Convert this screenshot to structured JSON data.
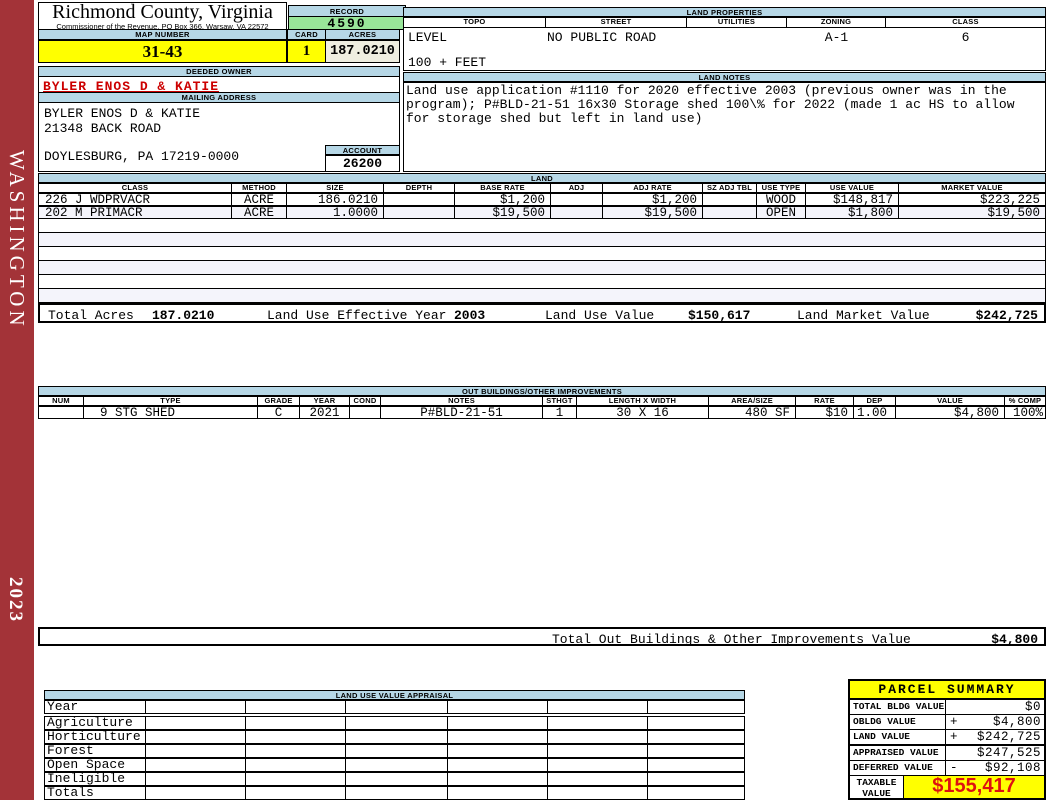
{
  "sidebar": {
    "county": "WASHINGTON",
    "year": "2023"
  },
  "header": {
    "county_title": "Richmond County, Virginia",
    "commissioner_line": "Commissioner of the Revenue, PO Box 366, Warsaw, VA 22572",
    "record_label": "RECORD",
    "record_value": "4590",
    "map_number_label": "MAP NUMBER",
    "map_number_value": "31-43",
    "card_label": "CARD",
    "card_value": "1",
    "acres_label": "ACRES",
    "acres_value": "187.0210"
  },
  "owner": {
    "deeded_owner_label": "DEEDED OWNER",
    "deeded_owner": "BYLER ENOS D & KATIE",
    "mailing_address_label": "MAILING ADDRESS",
    "mailing_line1": "BYLER ENOS D & KATIE",
    "mailing_line2": "21348 BACK ROAD",
    "mailing_city": "DOYLESBURG, PA 17219-0000",
    "account_label": "ACCOUNT",
    "account_value": "26200"
  },
  "land_properties": {
    "title": "LAND PROPERTIES",
    "columns": [
      "TOPO",
      "STREET",
      "UTILITIES",
      "ZONING",
      "CLASS"
    ],
    "topo": "LEVEL",
    "street": "NO PUBLIC ROAD",
    "utilities": "",
    "zoning": "A-1",
    "class": "6",
    "frontage": "100 + FEET"
  },
  "land_notes": {
    "title": "LAND NOTES",
    "line1": "Land use application #1110 for 2020 effective 2003 (previous owner was in the",
    "line2": "program); P#BLD-21-51 16x30 Storage shed 100\\% for 2022 (made 1 ac HS to allow",
    "line3": "for storage shed but left in land use)"
  },
  "land_table": {
    "title": "LAND",
    "columns": [
      "CLASS",
      "METHOD",
      "SIZE",
      "DEPTH",
      "BASE RATE",
      "ADJ",
      "ADJ RATE",
      "SZ ADJ TBL",
      "USE TYPE",
      "USE VALUE",
      "MARKET VALUE"
    ],
    "rows": [
      [
        "226 J WDPRVACR",
        "ACRE",
        "186.0210",
        "",
        "$1,200",
        "",
        "$1,200",
        "",
        "WOOD",
        "$148,817",
        "$223,225"
      ],
      [
        "202 M PRIMACR",
        "ACRE",
        "1.0000",
        "",
        "$19,500",
        "",
        "$19,500",
        "",
        "OPEN",
        "$1,800",
        "$19,500"
      ]
    ],
    "total_acres_label": "Total Acres",
    "total_acres": "187.0210",
    "effective_year_label": "Land Use Effective Year",
    "effective_year": "2003",
    "use_value_label": "Land Use Value",
    "use_value": "$150,617",
    "market_value_label": "Land Market Value",
    "market_value": "$242,725"
  },
  "out_buildings": {
    "title": "OUT BUILDINGS/OTHER IMPROVEMENTS",
    "columns": [
      "NUM",
      "TYPE",
      "GRADE",
      "YEAR",
      "COND",
      "NOTES",
      "STHGT",
      "LENGTH X WIDTH",
      "AREA/SIZE",
      "RATE",
      "DEP",
      "VALUE",
      "% COMP"
    ],
    "rows": [
      [
        "",
        "9 STG SHED",
        "C",
        "2021",
        "",
        "P#BLD-21-51",
        "1",
        "30 X 16",
        "480 SF",
        "$10",
        "1.00",
        "$4,800",
        "100%"
      ]
    ],
    "total_label": "Total Out Buildings & Other Improvements Value",
    "total_value": "$4,800"
  },
  "land_use_appraisal": {
    "title": "LAND USE VALUE APPRAISAL",
    "row_labels": [
      "Year",
      "Agriculture",
      "Horticulture",
      "Forest",
      "Open Space",
      "Ineligible",
      "Totals"
    ]
  },
  "parcel_summary": {
    "title": "PARCEL SUMMARY",
    "rows": [
      {
        "label": "TOTAL BLDG VALUE",
        "op": "",
        "value": "$0"
      },
      {
        "label": "OBLDG VALUE",
        "op": "+",
        "value": "$4,800"
      },
      {
        "label": "LAND VALUE",
        "op": "+",
        "value": "$242,725"
      },
      {
        "label": "APPRAISED VALUE",
        "op": "",
        "value": "$247,525"
      },
      {
        "label": "DEFERRED VALUE",
        "op": "-",
        "value": "$92,108"
      }
    ],
    "taxable_label_line1": "TAXABLE",
    "taxable_label_line2": "VALUE",
    "taxable_value": "$155,417"
  },
  "colors": {
    "sidebar_red": "#a33338",
    "strip_blue": "#b6d7e6",
    "highlight_yellow": "#ffff00",
    "record_green": "#99e699",
    "acres_beige": "#efeee0",
    "owner_red": "#cc0000",
    "taxable_red": "#dd1111"
  }
}
